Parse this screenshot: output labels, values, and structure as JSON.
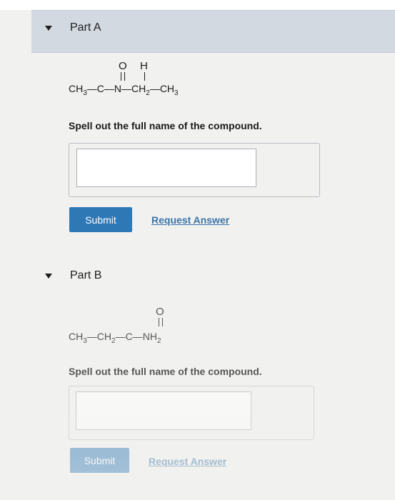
{
  "part_a": {
    "title": "Part A",
    "formula": {
      "top_o": "O",
      "top_h": "H",
      "chain": "CH3—C—N—CH2—CH3"
    },
    "prompt": "Spell out the full name of the compound.",
    "answer_value": "",
    "submit_label": "Submit",
    "request_label": "Request Answer"
  },
  "part_b": {
    "title": "Part B",
    "formula": {
      "top_o": "O",
      "chain": "CH3—CH2—C—NH2"
    },
    "prompt": "Spell out the full name of the compound.",
    "answer_value": "",
    "submit_label": "Submit",
    "request_label": "Request Answer"
  },
  "colors": {
    "header_bg": "#d3d9e1",
    "submit_bg": "#2e78b6",
    "link": "#3a74a8"
  },
  "icons": {
    "collapse_a": "caret-down-icon",
    "collapse_b": "caret-down-icon"
  }
}
